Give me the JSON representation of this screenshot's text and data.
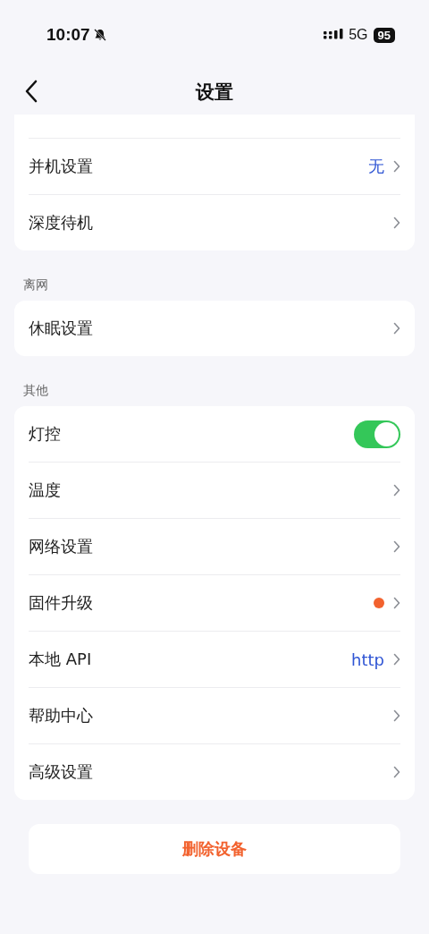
{
  "status_bar": {
    "time": "10:07",
    "network": "5G",
    "battery": "95"
  },
  "header": {
    "title": "设置"
  },
  "sections": [
    {
      "rows": [
        {
          "kind": "link",
          "label": "并机设置",
          "value": "无"
        },
        {
          "kind": "link",
          "label": "深度待机"
        }
      ]
    },
    {
      "label": "离网",
      "rows": [
        {
          "kind": "link",
          "label": "休眠设置"
        }
      ]
    },
    {
      "label": "其他",
      "rows": [
        {
          "kind": "toggle",
          "label": "灯控",
          "on": true
        },
        {
          "kind": "link",
          "label": "温度"
        },
        {
          "kind": "link",
          "label": "网络设置"
        },
        {
          "kind": "link",
          "label": "固件升级",
          "color": "#f2622e"
        },
        {
          "kind": "link",
          "label": "本地 API",
          "value": "http"
        },
        {
          "kind": "link",
          "label": "帮助中心"
        },
        {
          "kind": "link",
          "label": "高级设置"
        }
      ]
    }
  ],
  "delete_button": "删除设备"
}
